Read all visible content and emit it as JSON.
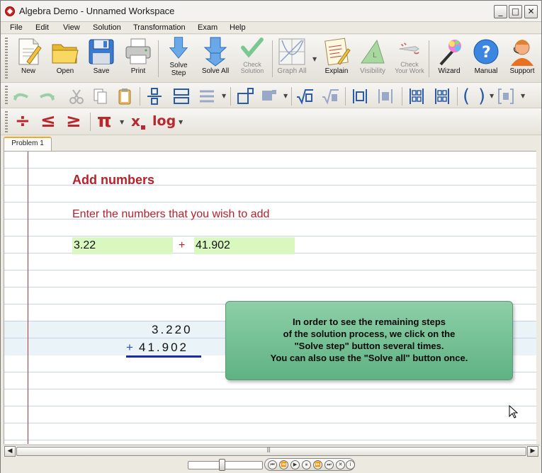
{
  "window": {
    "title": "Algebra Demo - Unnamed Workspace",
    "minimize": "_",
    "maximize": "□",
    "close": "✕"
  },
  "menu": [
    "File",
    "Edit",
    "View",
    "Solution",
    "Transformation",
    "Exam",
    "Help"
  ],
  "toolbar": {
    "new": "New",
    "open": "Open",
    "save": "Save",
    "print": "Print",
    "solve_step": "Solve\nStep",
    "solve_all": "Solve All",
    "check_solution": "Check\nSolution",
    "graph_all": "Graph All",
    "explain": "Explain",
    "visibility": "Visibility",
    "check_work": "Check\nYour Work",
    "wizard": "Wizard",
    "manual": "Manual",
    "support": "Support"
  },
  "symbols": {
    "divide": "÷",
    "le": "≤",
    "ge": "≥",
    "pi": "π",
    "subscript": "x",
    "log": "log",
    "open_paren": "(",
    "close_paren": ")"
  },
  "tabs": [
    "Problem 1"
  ],
  "problem": {
    "title": "Add numbers",
    "prompt": "Enter the numbers that you wish to add",
    "operand1": "3.22",
    "operator": "+",
    "operand2": "41.902"
  },
  "calculation": {
    "row1": "3.220",
    "plus": "+",
    "row2": "41.902"
  },
  "tooltip": {
    "lines": [
      "In order to see the remaining steps",
      "of the solution process, we click on the",
      "\"Solve step\" button several times.",
      "You can also use the \"Solve all\" button once."
    ]
  },
  "colors": {
    "accent_red": "#b8202a",
    "field_green": "#d8f8c0",
    "tooltip_green": "#6dbf8f",
    "blue_symbols": "#2a5aaa"
  }
}
